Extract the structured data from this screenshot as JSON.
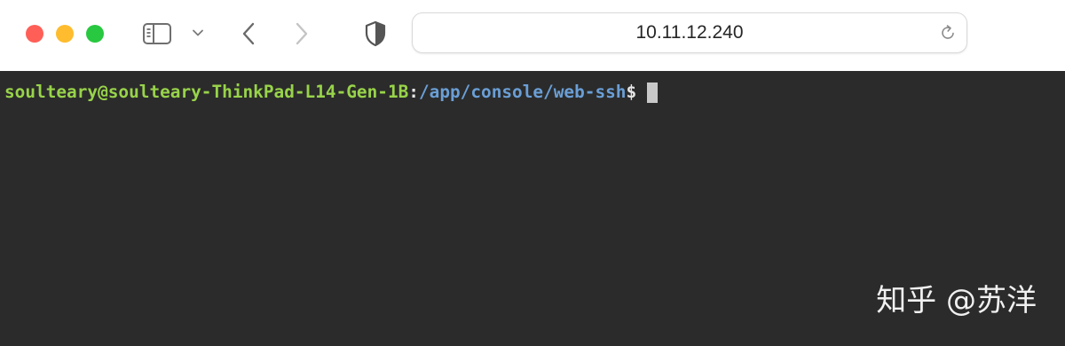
{
  "browser": {
    "address": "10.11.12.240",
    "icons": {
      "close": "close-dot",
      "minimize": "minimize-dot",
      "maximize": "maximize-dot",
      "sidebar": "sidebar-icon",
      "chevron": "chevron-down-icon",
      "back": "back-arrow-icon",
      "forward": "forward-arrow-icon",
      "privacy": "shield-icon",
      "reload": "reload-icon"
    },
    "colors": {
      "close": "#ff5f57",
      "minimize": "#febc2e",
      "maximize": "#28c840"
    }
  },
  "terminal": {
    "user_host": "soulteary@soulteary-ThinkPad-L14-Gen-1B",
    "colon": ":",
    "path": "/app/console/web-ssh",
    "dollar": "$",
    "colors": {
      "background": "#2b2b2b",
      "user_host": "#98d34a",
      "path": "#6a9fd6"
    }
  },
  "watermark": "知乎 @苏洋"
}
